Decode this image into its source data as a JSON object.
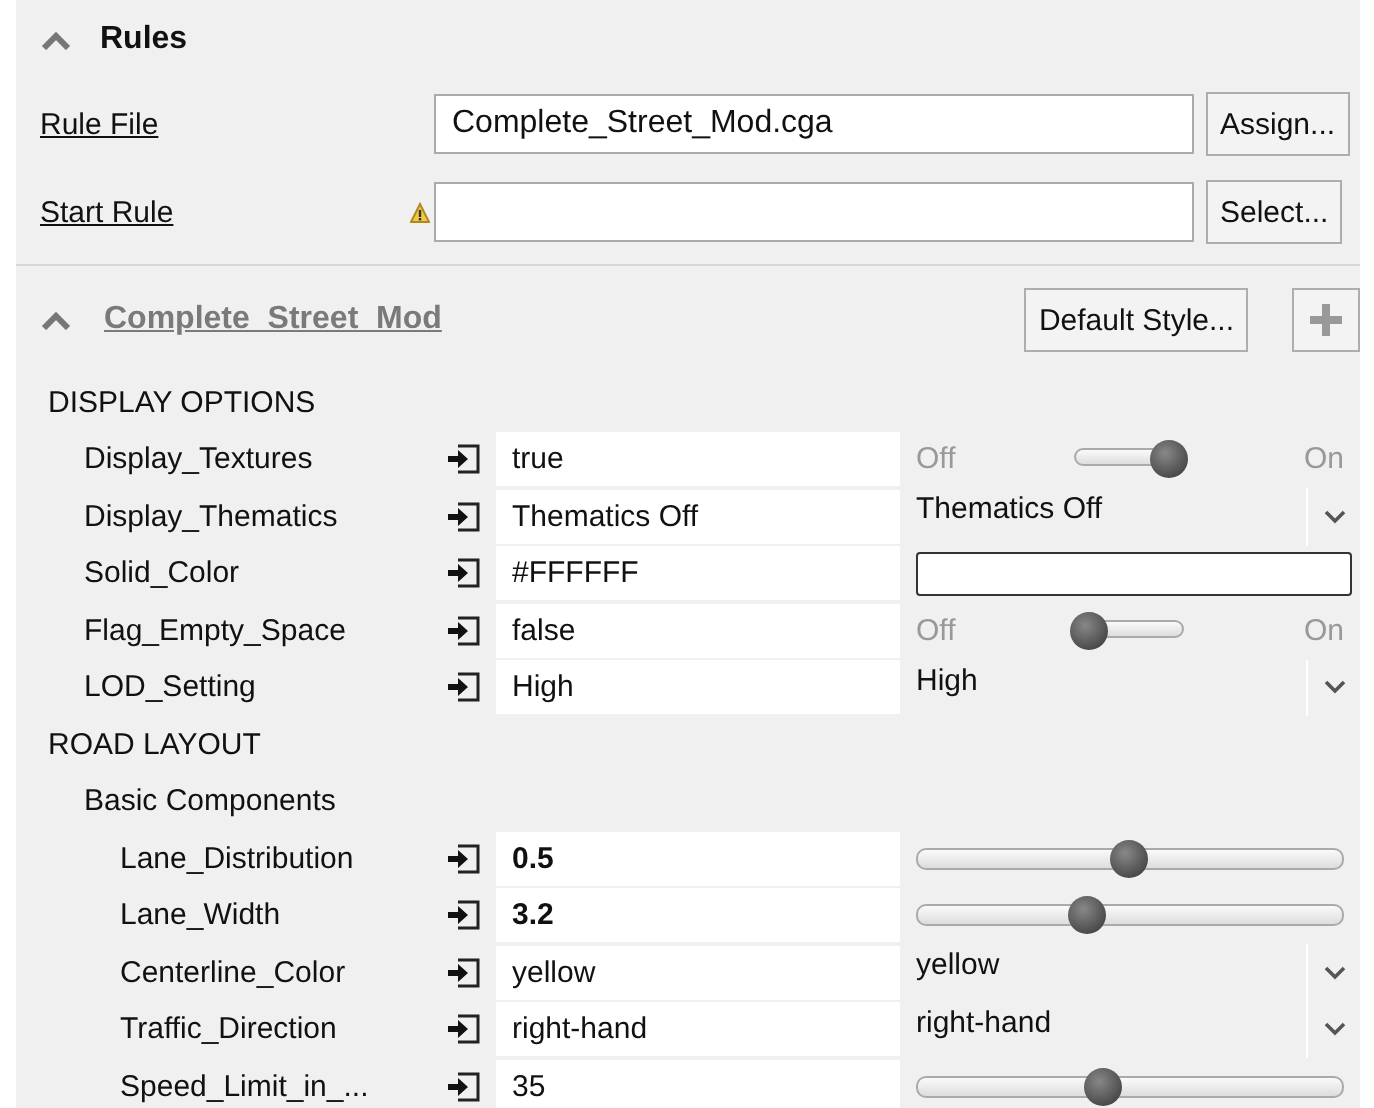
{
  "rules": {
    "title": "Rules",
    "expanded": true,
    "rule_file": {
      "label": "Rule File",
      "value": "Complete_Street_Mod.cga",
      "button": "Assign..."
    },
    "start_rule": {
      "label": "Start Rule",
      "warning": true,
      "button": "Select..."
    }
  },
  "style": {
    "title": "Complete_Street_Mod",
    "expanded": true,
    "button": "Default Style..."
  },
  "sections": [
    {
      "title": "DISPLAY OPTIONS",
      "groups": [
        {
          "attributes": [
            {
              "name": "Display_Textures",
              "value": "true",
              "user_set": false,
              "kind": "toggle",
              "on": true,
              "off_label": "Off",
              "on_label": "On"
            },
            {
              "name": "Display_Thematics",
              "value": "Thematics Off",
              "user_set": false,
              "kind": "dropdown",
              "choice": "Thematics Off"
            },
            {
              "name": "Solid_Color",
              "value": "#FFFFFF",
              "user_set": false,
              "kind": "color",
              "color": "#ffffff"
            },
            {
              "name": "Flag_Empty_Space",
              "value": "false",
              "user_set": false,
              "kind": "toggle",
              "on": false,
              "off_label": "Off",
              "on_label": "On"
            },
            {
              "name": "LOD_Setting",
              "value": "High",
              "user_set": false,
              "kind": "dropdown",
              "choice": "High"
            }
          ]
        }
      ]
    },
    {
      "title": "ROAD LAYOUT",
      "groups": [
        {
          "title": "Basic Components",
          "attributes": [
            {
              "name": "Lane_Distribution",
              "value": "0.5",
              "user_set": true,
              "kind": "slider",
              "level": 0.5
            },
            {
              "name": "Lane_Width",
              "value": "3.2",
              "user_set": true,
              "kind": "slider",
              "level": 0.4
            },
            {
              "name": "Centerline_Color",
              "value": "yellow",
              "user_set": false,
              "kind": "dropdown",
              "choice": "yellow"
            },
            {
              "name": "Traffic_Direction",
              "value": "right-hand",
              "user_set": false,
              "kind": "dropdown",
              "choice": "right-hand"
            },
            {
              "name": "Speed_Limit_in_...",
              "value": "35",
              "user_set": false,
              "kind": "slider",
              "level": 0.44
            }
          ]
        }
      ]
    }
  ]
}
